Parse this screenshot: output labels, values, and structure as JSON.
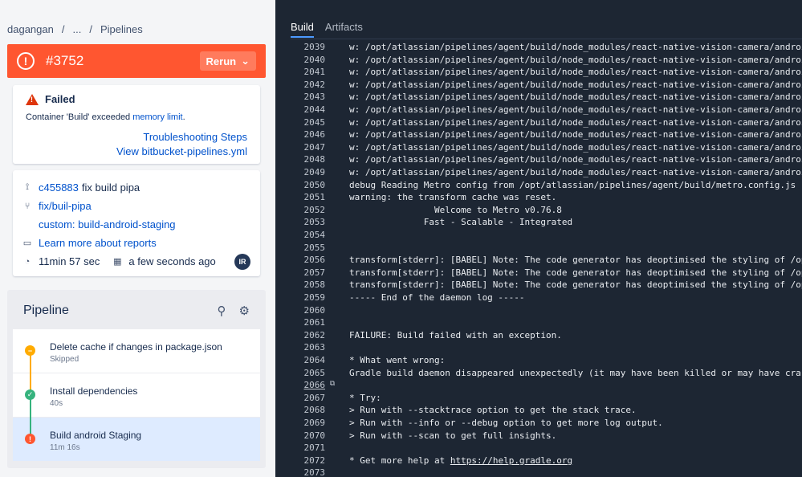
{
  "breadcrumb": [
    "dagangan",
    "/",
    "...",
    "/",
    "Pipelines"
  ],
  "header": {
    "number": "#3752",
    "rerun_label": "Rerun",
    "icon": "error-icon",
    "color": "#ff5630"
  },
  "failure": {
    "title": "Failed",
    "message_prefix": "Container 'Build' exceeded ",
    "message_link": "memory limit",
    "message_suffix": ".",
    "links": [
      "Troubleshooting Steps",
      "View bitbucket-pipelines.yml"
    ]
  },
  "info": {
    "commit_hash": "c455883",
    "commit_msg": "fix build pipa",
    "branch": "fix/buil-pipa",
    "custom": "custom: build-android-staging",
    "reports_link": "Learn more about reports",
    "duration": "11min 57 sec",
    "time_ago": "a few seconds ago",
    "avatar": "IR"
  },
  "pipeline": {
    "title": "Pipeline",
    "steps": [
      {
        "name": "Delete cache if changes in package.json",
        "sub": "Skipped",
        "status": "skipped",
        "color": "#ffab00"
      },
      {
        "name": "Install dependencies",
        "sub": "40s",
        "status": "success",
        "color": "#36b37e"
      },
      {
        "name": "Build android Staging",
        "sub": "11m 16s",
        "status": "failed",
        "color": "#ff5630"
      }
    ]
  },
  "tabs": [
    "Build",
    "Artifacts"
  ],
  "log": [
    {
      "n": "2039",
      "t": "w: /opt/atlassian/pipelines/agent/build/node_modules/react-native-vision-camera/android/sr"
    },
    {
      "n": "2040",
      "t": "w: /opt/atlassian/pipelines/agent/build/node_modules/react-native-vision-camera/android/sr"
    },
    {
      "n": "2041",
      "t": "w: /opt/atlassian/pipelines/agent/build/node_modules/react-native-vision-camera/android/sr"
    },
    {
      "n": "2042",
      "t": "w: /opt/atlassian/pipelines/agent/build/node_modules/react-native-vision-camera/android/sr"
    },
    {
      "n": "2043",
      "t": "w: /opt/atlassian/pipelines/agent/build/node_modules/react-native-vision-camera/android/sr"
    },
    {
      "n": "2044",
      "t": "w: /opt/atlassian/pipelines/agent/build/node_modules/react-native-vision-camera/android/sr"
    },
    {
      "n": "2045",
      "t": "w: /opt/atlassian/pipelines/agent/build/node_modules/react-native-vision-camera/android/sr"
    },
    {
      "n": "2046",
      "t": "w: /opt/atlassian/pipelines/agent/build/node_modules/react-native-vision-camera/android/sr"
    },
    {
      "n": "2047",
      "t": "w: /opt/atlassian/pipelines/agent/build/node_modules/react-native-vision-camera/android/sr"
    },
    {
      "n": "2048",
      "t": "w: /opt/atlassian/pipelines/agent/build/node_modules/react-native-vision-camera/android/sr"
    },
    {
      "n": "2049",
      "t": "w: /opt/atlassian/pipelines/agent/build/node_modules/react-native-vision-camera/android/sr"
    },
    {
      "n": "2050",
      "t": "debug Reading Metro config from /opt/atlassian/pipelines/agent/build/metro.config.js"
    },
    {
      "n": "2051",
      "t": "warning: the transform cache was reset."
    },
    {
      "n": "2052",
      "t": "                Welcome to Metro v0.76.8"
    },
    {
      "n": "2053",
      "t": "              Fast - Scalable - Integrated"
    },
    {
      "n": "2054",
      "t": ""
    },
    {
      "n": "2055",
      "t": ""
    },
    {
      "n": "2056",
      "t": "transform[stderr]: [BABEL] Note: The code generator has deoptimised the styling of /opt/at"
    },
    {
      "n": "2057",
      "t": "transform[stderr]: [BABEL] Note: The code generator has deoptimised the styling of /opt/at"
    },
    {
      "n": "2058",
      "t": "transform[stderr]: [BABEL] Note: The code generator has deoptimised the styling of /opt/at"
    },
    {
      "n": "2059",
      "t": "----- End of the daemon log -----"
    },
    {
      "n": "2060",
      "t": ""
    },
    {
      "n": "2061",
      "t": ""
    },
    {
      "n": "2062",
      "t": "FAILURE: Build failed with an exception."
    },
    {
      "n": "2063",
      "t": ""
    },
    {
      "n": "2064",
      "t": "* What went wrong:"
    },
    {
      "n": "2065",
      "t": "Gradle build daemon disappeared unexpectedly (it may have been killed or may have crashed)"
    },
    {
      "n": "2066",
      "t": "",
      "linked": true
    },
    {
      "n": "2067",
      "t": "* Try:"
    },
    {
      "n": "2068",
      "t": "> Run with --stacktrace option to get the stack trace."
    },
    {
      "n": "2069",
      "t": "> Run with --info or --debug option to get more log output."
    },
    {
      "n": "2070",
      "t": "> Run with --scan to get full insights."
    },
    {
      "n": "2071",
      "t": ""
    },
    {
      "n": "2072",
      "t": "* Get more help at ",
      "url": "https://help.gradle.org"
    },
    {
      "n": "2073",
      "t": ""
    }
  ]
}
